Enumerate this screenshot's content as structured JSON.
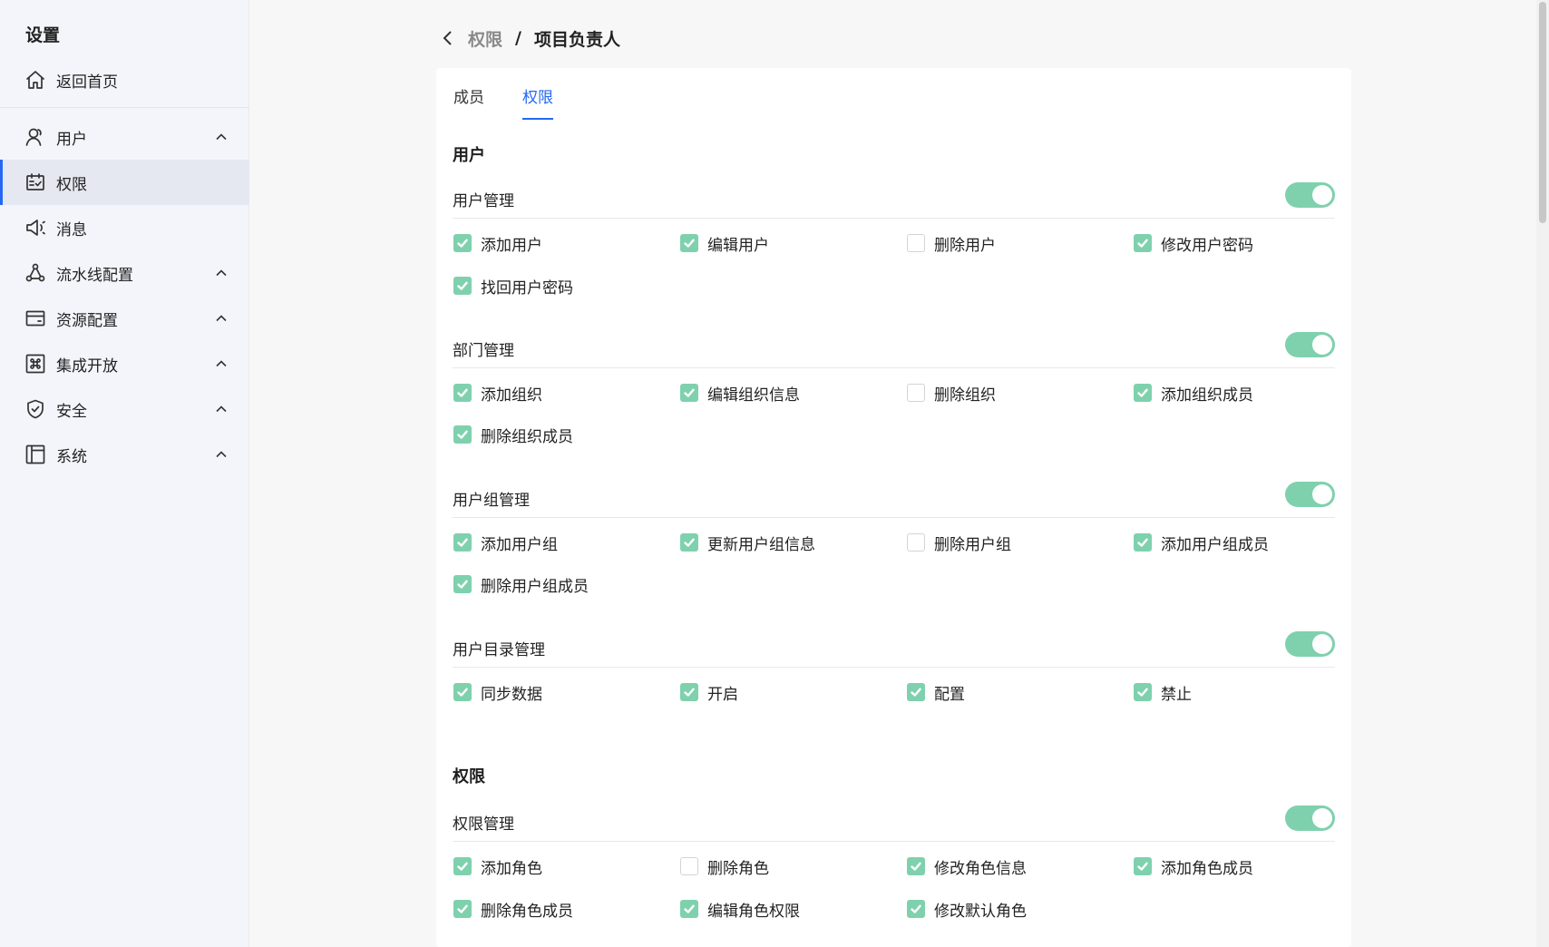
{
  "sidebar": {
    "title": "设置",
    "home": {
      "label": "返回首页",
      "icon": "home-icon"
    },
    "items": [
      {
        "label": "用户",
        "icon": "user-icon",
        "expandable": true
      },
      {
        "label": "权限",
        "icon": "calendar-check-icon",
        "active": true
      },
      {
        "label": "消息",
        "icon": "megaphone-icon"
      },
      {
        "label": "流水线配置",
        "icon": "pipeline-icon",
        "expandable": true
      },
      {
        "label": "资源配置",
        "icon": "card-icon",
        "expandable": true
      },
      {
        "label": "集成开放",
        "icon": "command-icon",
        "expandable": true
      },
      {
        "label": "安全",
        "icon": "shield-icon",
        "expandable": true
      },
      {
        "label": "系统",
        "icon": "layout-icon",
        "expandable": true
      }
    ]
  },
  "breadcrumb": {
    "parent": "权限",
    "separator": "/",
    "current": "项目负责人"
  },
  "tabs": [
    {
      "label": "成员"
    },
    {
      "label": "权限",
      "active": true
    }
  ],
  "sections": [
    {
      "title": "用户",
      "groups": [
        {
          "label": "用户管理",
          "enabled": true,
          "perms": [
            {
              "label": "添加用户",
              "checked": true
            },
            {
              "label": "编辑用户",
              "checked": true
            },
            {
              "label": "删除用户",
              "checked": false
            },
            {
              "label": "修改用户密码",
              "checked": true
            },
            {
              "label": "找回用户密码",
              "checked": true
            }
          ]
        },
        {
          "label": "部门管理",
          "enabled": true,
          "perms": [
            {
              "label": "添加组织",
              "checked": true
            },
            {
              "label": "编辑组织信息",
              "checked": true
            },
            {
              "label": "删除组织",
              "checked": false
            },
            {
              "label": "添加组织成员",
              "checked": true
            },
            {
              "label": "删除组织成员",
              "checked": true
            }
          ]
        },
        {
          "label": "用户组管理",
          "enabled": true,
          "perms": [
            {
              "label": "添加用户组",
              "checked": true
            },
            {
              "label": "更新用户组信息",
              "checked": true
            },
            {
              "label": "删除用户组",
              "checked": false
            },
            {
              "label": "添加用户组成员",
              "checked": true
            },
            {
              "label": "删除用户组成员",
              "checked": true
            }
          ]
        },
        {
          "label": "用户目录管理",
          "enabled": true,
          "perms": [
            {
              "label": "同步数据",
              "checked": true
            },
            {
              "label": "开启",
              "checked": true
            },
            {
              "label": "配置",
              "checked": true
            },
            {
              "label": "禁止",
              "checked": true
            }
          ]
        }
      ]
    },
    {
      "title": "权限",
      "groups": [
        {
          "label": "权限管理",
          "enabled": true,
          "perms": [
            {
              "label": "添加角色",
              "checked": true
            },
            {
              "label": "删除角色",
              "checked": false
            },
            {
              "label": "修改角色信息",
              "checked": true
            },
            {
              "label": "添加角色成员",
              "checked": true
            },
            {
              "label": "删除角色成员",
              "checked": true
            },
            {
              "label": "编辑角色权限",
              "checked": true
            },
            {
              "label": "修改默认角色",
              "checked": true
            }
          ]
        }
      ]
    }
  ],
  "colors": {
    "accent": "#2468f2",
    "toggle_on": "#7fd1ae",
    "check_on": "#7fd1ae"
  }
}
